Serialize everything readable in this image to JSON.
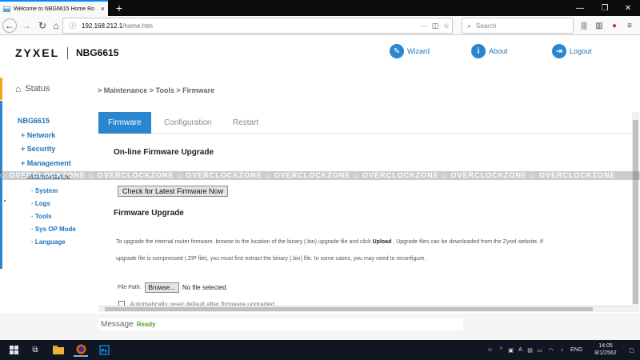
{
  "browser": {
    "tab_title": "Welcome to NBG6615 Home Ro",
    "tab_close": "×",
    "new_tab": "+",
    "url_host": "192.168.212.1",
    "url_path": "/home.htm",
    "search_placeholder": "Search",
    "win_minimize": "—",
    "win_restore": "❐",
    "win_close": "✕"
  },
  "header": {
    "logo": "ZYXEL",
    "model": "NBG6615",
    "wizard_label": "Wizard",
    "about_label": "About",
    "logout_label": "Logout"
  },
  "sidebar": {
    "status_label": "Status",
    "device": "NBG6615",
    "items": [
      {
        "label": "+ Network"
      },
      {
        "label": "+ Security"
      },
      {
        "label": "+ Management"
      },
      {
        "label": "− Maintenance"
      }
    ],
    "subitems": [
      {
        "label": "· System"
      },
      {
        "label": "· Logs"
      },
      {
        "label": "· Tools"
      },
      {
        "label": "· Sys OP Mode"
      },
      {
        "label": "· Language"
      }
    ]
  },
  "breadcrumb": "> Maintenance > Tools > Firmware",
  "tabs": [
    {
      "label": "Firmware",
      "active": true
    },
    {
      "label": "Configuration",
      "active": false
    },
    {
      "label": "Restart",
      "active": false
    }
  ],
  "online": {
    "title": "On-line Firmware Upgrade",
    "button": "Check for Latest Firmware Now"
  },
  "upgrade": {
    "title": "Firmware Upgrade",
    "desc1_a": "To upgrade the internal router firmware, browse to the location of the binary (.bin) upgrade file and click ",
    "desc1_b": "Upload",
    "desc1_c": " . Upgrade files can be downloaded from the Zyxel website. If",
    "desc2": "upgrade file is compressed (.ZIP file), you must first extract the binary (.bin) file. In some cases, you may need to reconfigure.",
    "file_path_label": "File Path:",
    "browse_button": "Browse...",
    "no_file": "No file selected.",
    "auto_reset": "Automatically reset default after firmware upgraded"
  },
  "watermark": "◇ OVERCLOCKZONE ◇ OVERCLOCKZONE ◇ OVERCLOCKZONE ◇ OVERCLOCKZONE ◇ OVERCLOCKZONE ◇ OVERCLOCKZONE ◇ OVERCLOCKZONE",
  "message": {
    "label": "Message",
    "status": "Ready"
  },
  "taskbar": {
    "lang": "ENG",
    "time": "14:05",
    "date": "8/1/2562"
  },
  "colors": {
    "accent": "#2a86cf",
    "status_bar": "#f2a41c",
    "ready": "#5aa02c"
  }
}
